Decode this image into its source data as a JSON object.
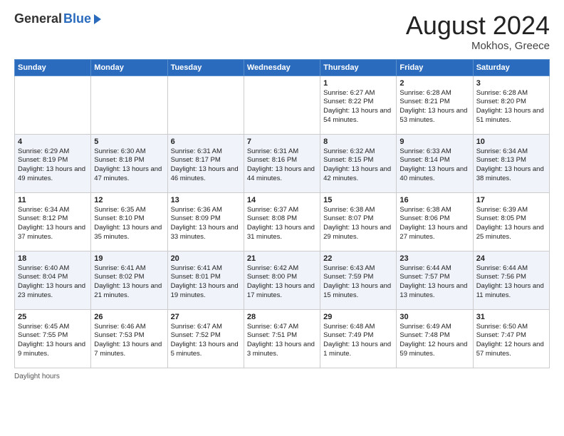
{
  "header": {
    "logo_general": "General",
    "logo_blue": "Blue",
    "title": "August 2024",
    "subtitle": "Mokhos, Greece"
  },
  "footer": {
    "daylight_hours": "Daylight hours"
  },
  "columns": [
    "Sunday",
    "Monday",
    "Tuesday",
    "Wednesday",
    "Thursday",
    "Friday",
    "Saturday"
  ],
  "weeks": [
    [
      {
        "day": "",
        "sunrise": "",
        "sunset": "",
        "daylight": ""
      },
      {
        "day": "",
        "sunrise": "",
        "sunset": "",
        "daylight": ""
      },
      {
        "day": "",
        "sunrise": "",
        "sunset": "",
        "daylight": ""
      },
      {
        "day": "",
        "sunrise": "",
        "sunset": "",
        "daylight": ""
      },
      {
        "day": "1",
        "sunrise": "Sunrise: 6:27 AM",
        "sunset": "Sunset: 8:22 PM",
        "daylight": "Daylight: 13 hours and 54 minutes."
      },
      {
        "day": "2",
        "sunrise": "Sunrise: 6:28 AM",
        "sunset": "Sunset: 8:21 PM",
        "daylight": "Daylight: 13 hours and 53 minutes."
      },
      {
        "day": "3",
        "sunrise": "Sunrise: 6:28 AM",
        "sunset": "Sunset: 8:20 PM",
        "daylight": "Daylight: 13 hours and 51 minutes."
      }
    ],
    [
      {
        "day": "4",
        "sunrise": "Sunrise: 6:29 AM",
        "sunset": "Sunset: 8:19 PM",
        "daylight": "Daylight: 13 hours and 49 minutes."
      },
      {
        "day": "5",
        "sunrise": "Sunrise: 6:30 AM",
        "sunset": "Sunset: 8:18 PM",
        "daylight": "Daylight: 13 hours and 47 minutes."
      },
      {
        "day": "6",
        "sunrise": "Sunrise: 6:31 AM",
        "sunset": "Sunset: 8:17 PM",
        "daylight": "Daylight: 13 hours and 46 minutes."
      },
      {
        "day": "7",
        "sunrise": "Sunrise: 6:31 AM",
        "sunset": "Sunset: 8:16 PM",
        "daylight": "Daylight: 13 hours and 44 minutes."
      },
      {
        "day": "8",
        "sunrise": "Sunrise: 6:32 AM",
        "sunset": "Sunset: 8:15 PM",
        "daylight": "Daylight: 13 hours and 42 minutes."
      },
      {
        "day": "9",
        "sunrise": "Sunrise: 6:33 AM",
        "sunset": "Sunset: 8:14 PM",
        "daylight": "Daylight: 13 hours and 40 minutes."
      },
      {
        "day": "10",
        "sunrise": "Sunrise: 6:34 AM",
        "sunset": "Sunset: 8:13 PM",
        "daylight": "Daylight: 13 hours and 38 minutes."
      }
    ],
    [
      {
        "day": "11",
        "sunrise": "Sunrise: 6:34 AM",
        "sunset": "Sunset: 8:12 PM",
        "daylight": "Daylight: 13 hours and 37 minutes."
      },
      {
        "day": "12",
        "sunrise": "Sunrise: 6:35 AM",
        "sunset": "Sunset: 8:10 PM",
        "daylight": "Daylight: 13 hours and 35 minutes."
      },
      {
        "day": "13",
        "sunrise": "Sunrise: 6:36 AM",
        "sunset": "Sunset: 8:09 PM",
        "daylight": "Daylight: 13 hours and 33 minutes."
      },
      {
        "day": "14",
        "sunrise": "Sunrise: 6:37 AM",
        "sunset": "Sunset: 8:08 PM",
        "daylight": "Daylight: 13 hours and 31 minutes."
      },
      {
        "day": "15",
        "sunrise": "Sunrise: 6:38 AM",
        "sunset": "Sunset: 8:07 PM",
        "daylight": "Daylight: 13 hours and 29 minutes."
      },
      {
        "day": "16",
        "sunrise": "Sunrise: 6:38 AM",
        "sunset": "Sunset: 8:06 PM",
        "daylight": "Daylight: 13 hours and 27 minutes."
      },
      {
        "day": "17",
        "sunrise": "Sunrise: 6:39 AM",
        "sunset": "Sunset: 8:05 PM",
        "daylight": "Daylight: 13 hours and 25 minutes."
      }
    ],
    [
      {
        "day": "18",
        "sunrise": "Sunrise: 6:40 AM",
        "sunset": "Sunset: 8:04 PM",
        "daylight": "Daylight: 13 hours and 23 minutes."
      },
      {
        "day": "19",
        "sunrise": "Sunrise: 6:41 AM",
        "sunset": "Sunset: 8:02 PM",
        "daylight": "Daylight: 13 hours and 21 minutes."
      },
      {
        "day": "20",
        "sunrise": "Sunrise: 6:41 AM",
        "sunset": "Sunset: 8:01 PM",
        "daylight": "Daylight: 13 hours and 19 minutes."
      },
      {
        "day": "21",
        "sunrise": "Sunrise: 6:42 AM",
        "sunset": "Sunset: 8:00 PM",
        "daylight": "Daylight: 13 hours and 17 minutes."
      },
      {
        "day": "22",
        "sunrise": "Sunrise: 6:43 AM",
        "sunset": "Sunset: 7:59 PM",
        "daylight": "Daylight: 13 hours and 15 minutes."
      },
      {
        "day": "23",
        "sunrise": "Sunrise: 6:44 AM",
        "sunset": "Sunset: 7:57 PM",
        "daylight": "Daylight: 13 hours and 13 minutes."
      },
      {
        "day": "24",
        "sunrise": "Sunrise: 6:44 AM",
        "sunset": "Sunset: 7:56 PM",
        "daylight": "Daylight: 13 hours and 11 minutes."
      }
    ],
    [
      {
        "day": "25",
        "sunrise": "Sunrise: 6:45 AM",
        "sunset": "Sunset: 7:55 PM",
        "daylight": "Daylight: 13 hours and 9 minutes."
      },
      {
        "day": "26",
        "sunrise": "Sunrise: 6:46 AM",
        "sunset": "Sunset: 7:53 PM",
        "daylight": "Daylight: 13 hours and 7 minutes."
      },
      {
        "day": "27",
        "sunrise": "Sunrise: 6:47 AM",
        "sunset": "Sunset: 7:52 PM",
        "daylight": "Daylight: 13 hours and 5 minutes."
      },
      {
        "day": "28",
        "sunrise": "Sunrise: 6:47 AM",
        "sunset": "Sunset: 7:51 PM",
        "daylight": "Daylight: 13 hours and 3 minutes."
      },
      {
        "day": "29",
        "sunrise": "Sunrise: 6:48 AM",
        "sunset": "Sunset: 7:49 PM",
        "daylight": "Daylight: 13 hours and 1 minute."
      },
      {
        "day": "30",
        "sunrise": "Sunrise: 6:49 AM",
        "sunset": "Sunset: 7:48 PM",
        "daylight": "Daylight: 12 hours and 59 minutes."
      },
      {
        "day": "31",
        "sunrise": "Sunrise: 6:50 AM",
        "sunset": "Sunset: 7:47 PM",
        "daylight": "Daylight: 12 hours and 57 minutes."
      }
    ]
  ]
}
